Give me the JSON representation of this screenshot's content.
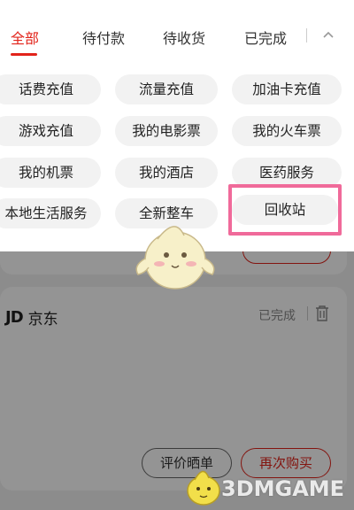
{
  "tabs": [
    {
      "label": "全部"
    },
    {
      "label": "待付款"
    },
    {
      "label": "待收货"
    },
    {
      "label": "已完成"
    }
  ],
  "categories": [
    {
      "label": "话费充值"
    },
    {
      "label": "流量充值"
    },
    {
      "label": "加油卡充值"
    },
    {
      "label": "游戏充值"
    },
    {
      "label": "我的电影票"
    },
    {
      "label": "我的火车票"
    },
    {
      "label": "我的机票"
    },
    {
      "label": "我的酒店"
    },
    {
      "label": "医药服务"
    },
    {
      "label": "本地生活服务"
    },
    {
      "label": "全新整车"
    },
    {
      "label": "回收站"
    }
  ],
  "order": {
    "store_logo": "JD",
    "store_name": "京东",
    "status": "已完成",
    "review_button": "评价晒单",
    "rebuy_button": "再次购买"
  },
  "icons": {
    "collapse": "chevron-up-icon",
    "delete": "trash-icon"
  },
  "watermark": "3DMGAME",
  "colors": {
    "accent": "#e2231a",
    "highlight": "#f06a9a"
  }
}
